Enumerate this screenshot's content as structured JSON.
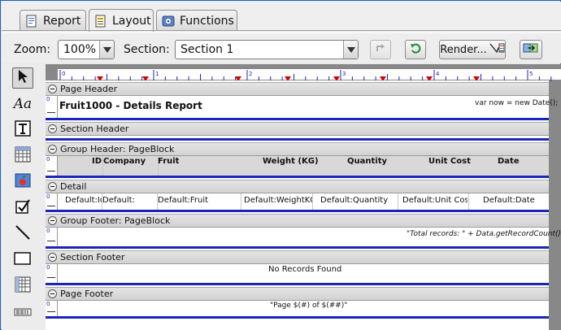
{
  "tabs": [
    {
      "label": "Report",
      "icon": "report-tab-icon"
    },
    {
      "label": "Layout",
      "icon": "layout-tab-icon"
    },
    {
      "label": "Functions",
      "icon": "functions-tab-icon"
    }
  ],
  "toolbar": {
    "zoom_label": "Zoom:",
    "zoom_value": "100%",
    "section_label": "Section:",
    "section_value": "Section 1",
    "render_label": "Render..."
  },
  "ruler": {
    "numbers": [
      "0",
      "1",
      "2",
      "3",
      "4",
      "5"
    ]
  },
  "bands": {
    "page_header": "Page Header",
    "section_header": "Section Header",
    "group_header": "Group Header: PageBlock",
    "detail": "Detail",
    "group_footer": "Group Footer: PageBlock",
    "section_footer": "Section Footer",
    "page_footer": "Page Footer"
  },
  "page_header": {
    "title": "Fruit1000 - Details Report",
    "script": "var now = new Date();"
  },
  "columns": {
    "headers": [
      "ID",
      "Company",
      "Fruit",
      "Weight (KG)",
      "Quantity",
      "Unit Cost",
      "Date"
    ],
    "detail": [
      "Default:Id",
      "Default:",
      "Default:Fruit",
      "Default:WeightKG",
      "Default:Quantity",
      "Default:Unit Cost",
      "Default:Date"
    ]
  },
  "group_footer": {
    "text": "\"Total records: \" + Data.getRecordCount();"
  },
  "section_footer": {
    "text": "No Records Found"
  },
  "page_footer": {
    "text": "\"Page $(#) of $(##)\""
  }
}
